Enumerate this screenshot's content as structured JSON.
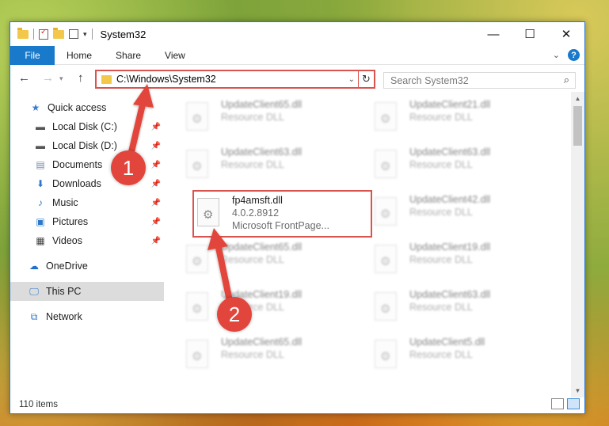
{
  "window": {
    "title": "System32"
  },
  "window_controls": {
    "minimize": "—",
    "maximize": "☐",
    "close": "✕"
  },
  "ribbon": {
    "tabs": [
      "File",
      "Home",
      "Share",
      "View"
    ]
  },
  "address": {
    "path": "C:\\Windows\\System32"
  },
  "search": {
    "placeholder": "Search System32"
  },
  "nav": {
    "items": [
      {
        "label": "Quick access",
        "icon": "star-icon"
      },
      {
        "label": "Local Disk (C:)",
        "icon": "drive-icon"
      },
      {
        "label": "Local Disk (D:)",
        "icon": "drive-icon"
      },
      {
        "label": "Documents",
        "icon": "documents-icon"
      },
      {
        "label": "Downloads",
        "icon": "download-icon"
      },
      {
        "label": "Music",
        "icon": "music-icon"
      },
      {
        "label": "Pictures",
        "icon": "pictures-icon"
      },
      {
        "label": "Videos",
        "icon": "videos-icon"
      },
      {
        "label": "OneDrive",
        "icon": "cloud-icon"
      },
      {
        "label": "This PC",
        "icon": "computer-icon"
      },
      {
        "label": "Network",
        "icon": "network-icon"
      }
    ]
  },
  "files": [
    {
      "name": "UpdateClient65.dll",
      "sub": "Resource DLL"
    },
    {
      "name": "UpdateClient21.dll",
      "sub": "Resource DLL"
    },
    {
      "name": "UpdateClient63.dll",
      "sub": "Resource DLL"
    },
    {
      "name": "UpdateClient63.dll",
      "sub": "Resource DLL"
    },
    {
      "name": "fp4amsft.dll",
      "sub": "4.0.2.8912",
      "sub2": "Microsoft FrontPage..."
    },
    {
      "name": "UpdateClient42.dll",
      "sub": "Resource DLL"
    },
    {
      "name": "UpdateClient65.dll",
      "sub": "Resource DLL"
    },
    {
      "name": "UpdateClient19.dll",
      "sub": "Resource DLL"
    },
    {
      "name": "UpdateClient19.dll",
      "sub": "Resource DLL"
    },
    {
      "name": "UpdateClient63.dll",
      "sub": "Resource DLL"
    },
    {
      "name": "UpdateClient65.dll",
      "sub": "Resource DLL"
    },
    {
      "name": "UpdateClient5.dll",
      "sub": "Resource DLL"
    }
  ],
  "status": {
    "count": "110 items"
  },
  "annotations": {
    "step1": "1",
    "step2": "2"
  },
  "colors": {
    "accent": "#1979ca",
    "highlight": "#d9534f",
    "badge": "#e2453b"
  }
}
